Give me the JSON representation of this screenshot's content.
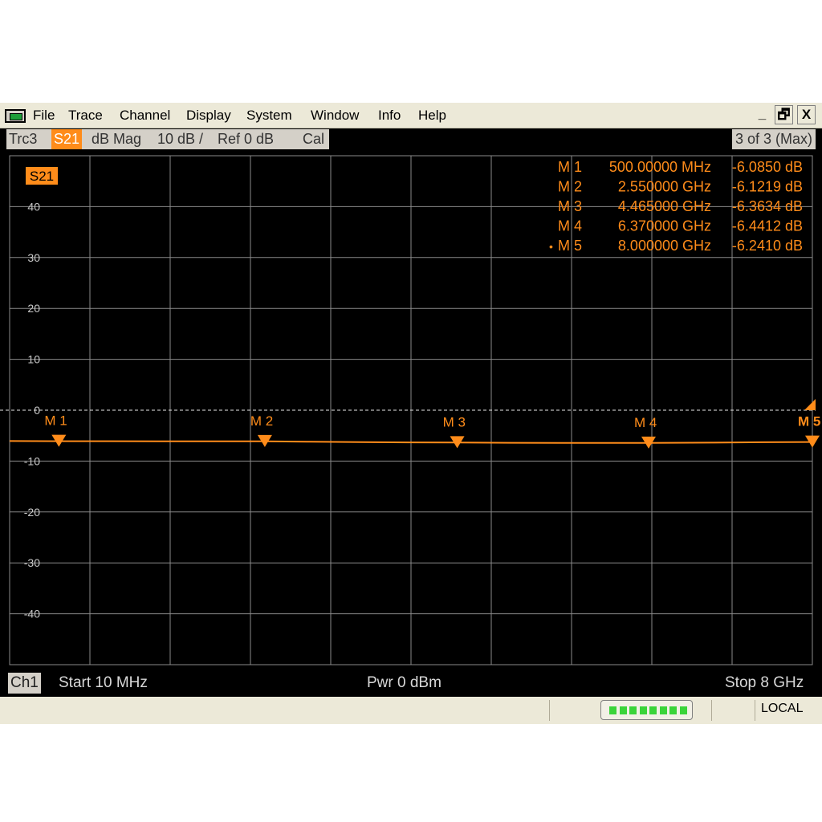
{
  "menubar": {
    "items": [
      "File",
      "Trace",
      "Channel",
      "Display",
      "System",
      "Window",
      "Info",
      "Help"
    ],
    "window_buttons": [
      "_",
      "🗗",
      "X"
    ]
  },
  "trace_header": {
    "trace_name": "Trc3",
    "parameter": "S21",
    "format": "dB Mag",
    "scale": "10 dB /",
    "ref": "Ref 0 dB",
    "cal": "Cal",
    "page": "3 of 3 (Max)"
  },
  "plot": {
    "trace_label": "S21",
    "trace_color": "#ff8c1a",
    "grid_color": "#8a8a8a",
    "y_axis_labels": [
      "40",
      "30",
      "20",
      "10",
      "0",
      "-10",
      "-20",
      "-30",
      "-40"
    ]
  },
  "marker_table": [
    {
      "name": "M 1",
      "freq": "500.00000 MHz",
      "value": "-6.0850 dB",
      "active": false
    },
    {
      "name": "M 2",
      "freq": "2.550000 GHz",
      "value": "-6.1219 dB",
      "active": false
    },
    {
      "name": "M 3",
      "freq": "4.465000 GHz",
      "value": "-6.3634 dB",
      "active": false
    },
    {
      "name": "M 4",
      "freq": "6.370000 GHz",
      "value": "-6.4412 dB",
      "active": false
    },
    {
      "name": "M 5",
      "freq": "8.000000 GHz",
      "value": "-6.2410 dB",
      "active": true
    }
  ],
  "chart_data": {
    "type": "line",
    "xlim_ghz": [
      0.01,
      8
    ],
    "ylim_db": [
      -50,
      50
    ],
    "y_divisions_db": 10,
    "x_divisions": 10,
    "reference_level_db": 0,
    "series": [
      {
        "name": "S21",
        "x_ghz": [
          0.01,
          0.5,
          1.0,
          1.5,
          2.0,
          2.55,
          3.0,
          3.5,
          4.0,
          4.465,
          5.0,
          5.5,
          6.0,
          6.37,
          7.0,
          7.5,
          8.0
        ],
        "y_db": [
          -6.05,
          -6.085,
          -6.09,
          -6.1,
          -6.11,
          -6.122,
          -6.2,
          -6.28,
          -6.33,
          -6.363,
          -6.4,
          -6.42,
          -6.43,
          -6.441,
          -6.38,
          -6.3,
          -6.241
        ]
      }
    ],
    "markers": [
      {
        "label": "M 1",
        "x_ghz": 0.5,
        "y_db": -6.085
      },
      {
        "label": "M 2",
        "x_ghz": 2.55,
        "y_db": -6.1219
      },
      {
        "label": "M 3",
        "x_ghz": 4.465,
        "y_db": -6.3634
      },
      {
        "label": "M 4",
        "x_ghz": 6.37,
        "y_db": -6.4412
      },
      {
        "label": "M 5",
        "x_ghz": 8.0,
        "y_db": -6.241
      }
    ]
  },
  "status": {
    "channel": "Ch1",
    "start": "Start  10 MHz",
    "power": "Pwr  0 dBm",
    "stop": "Stop  8 GHz"
  },
  "footer": {
    "led_count": 8,
    "mode": "LOCAL"
  }
}
